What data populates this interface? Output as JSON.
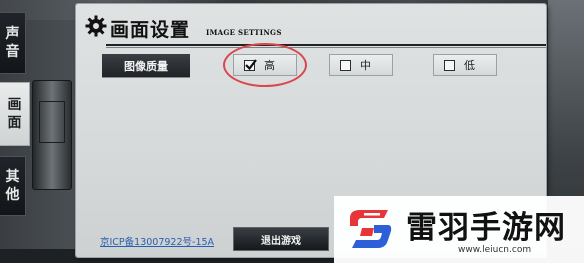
{
  "side_tabs": [
    {
      "label": "声音",
      "active": false
    },
    {
      "label": "画面",
      "active": true
    },
    {
      "label": "其他",
      "active": false
    }
  ],
  "panel": {
    "title": "画面设置",
    "subtitle": "IMAGE SETTINGS",
    "icon": "gear-icon"
  },
  "quality": {
    "label": "图像质量",
    "options": [
      {
        "label": "高",
        "checked": true
      },
      {
        "label": "中",
        "checked": false
      },
      {
        "label": "低",
        "checked": false
      }
    ]
  },
  "footer": {
    "icp": "京ICP备13007922号-15A",
    "exit_label": "退出游戏"
  },
  "watermark": {
    "title": "雷羽手游网",
    "url": "www.leiucn.com"
  },
  "colors": {
    "panel_bg": "#d6dadb",
    "dark_button": "#1f2327",
    "highlight": "#d9474a",
    "link": "#2a5fb0",
    "logo_red": "#e8353a",
    "logo_blue": "#2f5fd8"
  }
}
